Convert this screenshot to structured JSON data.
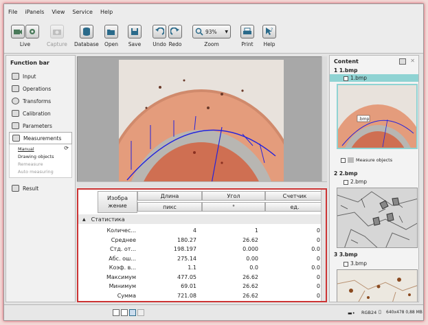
{
  "menu": [
    "File",
    "iPanels",
    "View",
    "Service",
    "Help"
  ],
  "toolbar": {
    "live": "Live",
    "capture": "Capture",
    "database": "Database",
    "open": "Open",
    "save": "Save",
    "undo": "Undo",
    "redo": "Redo",
    "zoom_value": "93%",
    "zoom": "Zoom",
    "print": "Print",
    "help": "Help"
  },
  "function_bar": {
    "title": "Function bar",
    "items": [
      "Input",
      "Operations",
      "Transforms",
      "Calibration",
      "Parameters",
      "Measurements"
    ],
    "sub_items": [
      "Manual",
      "Drawing objects",
      "Remeasure",
      "Auto measuring"
    ],
    "result": "Result"
  },
  "table": {
    "col_image": "Изобра жение",
    "headers": [
      "Длина",
      "Угол",
      "Счетчик"
    ],
    "units": [
      "пикс",
      "°",
      "ед."
    ],
    "stat_title": "Статистика",
    "rows": [
      {
        "label": "Количес...",
        "length": "4",
        "angle": "1",
        "count": "0"
      },
      {
        "label": "Среднее",
        "length": "180.27",
        "angle": "26.62",
        "count": "0"
      },
      {
        "label": "Стд. от...",
        "length": "198.197",
        "angle": "0.000",
        "count": "0.0"
      },
      {
        "label": "Абс. ош...",
        "length": "275.14",
        "angle": "0.00",
        "count": "0"
      },
      {
        "label": "Коэф. в...",
        "length": "1.1",
        "angle": "0.0",
        "count": "0.0"
      },
      {
        "label": "Максимум",
        "length": "477.05",
        "angle": "26.62",
        "count": "0"
      },
      {
        "label": "Минимум",
        "length": "69.01",
        "angle": "26.62",
        "count": "0"
      },
      {
        "label": "Сумма",
        "length": "721.08",
        "angle": "26.62",
        "count": "0"
      }
    ]
  },
  "content": {
    "title": "Content",
    "node1": "1  1.bmp",
    "node1_child": "1.bmp",
    "thumb_label": ".bmp",
    "measure_objects": "Measure objects",
    "node2": "2  2.bmp",
    "node2_child": "2.bmp",
    "node3": "3  3.bmp",
    "node3_child": "3.bmp"
  },
  "status": {
    "mode": "RGB24",
    "size": "640x478 0,88 MB"
  },
  "colors": {
    "accent": "#cc3333",
    "selection": "#8fd3d3",
    "measure_line": "#2222dd"
  }
}
